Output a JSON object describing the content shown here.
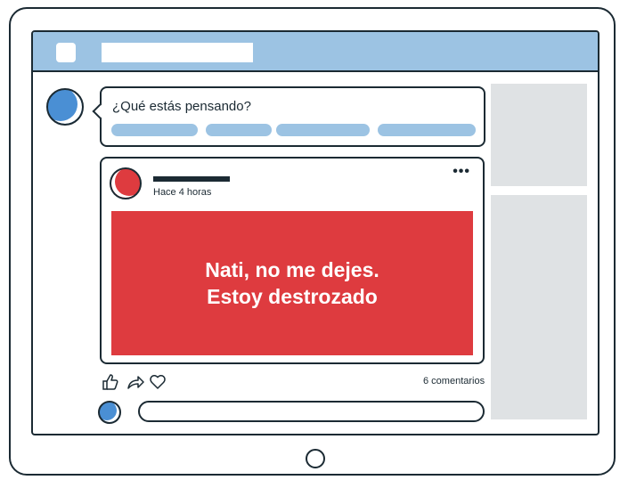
{
  "composer": {
    "prompt": "¿Qué estás pensando?"
  },
  "post": {
    "time": "Hace 4 horas",
    "message_line1": "Nati, no me dejes.",
    "message_line2": "Estoy destrozado",
    "comments": "6 comentarios"
  },
  "icons": {
    "menu": "menu-square-icon",
    "more": "more-options-icon",
    "like": "thumbs-up-icon",
    "share": "share-arrow-icon",
    "heart": "heart-icon",
    "home": "home-button-icon"
  },
  "colors": {
    "accent_blue": "#9cc3e3",
    "avatar_blue": "#4a8fd4",
    "post_red": "#de3b3f",
    "outline": "#1b2a33",
    "sidebar_gray": "#dfe2e4"
  }
}
